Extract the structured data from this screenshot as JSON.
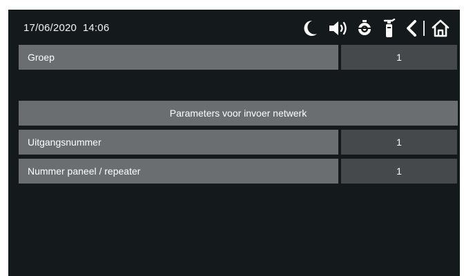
{
  "status_bar": {
    "date": "17/06/2020",
    "time": "14:06",
    "icons": [
      "moon-icon",
      "speaker-icon",
      "alarm-bell-icon",
      "fire-extinguisher-icon",
      "back-icon",
      "home-icon"
    ]
  },
  "rows": {
    "groep": {
      "label": "Groep",
      "value": "1"
    },
    "uitgangsnummer": {
      "label": "Uitgangsnummer",
      "value": "1"
    },
    "nummer_paneel": {
      "label": "Nummer paneel / repeater",
      "value": "1"
    }
  },
  "section": {
    "title": "Parameters voor invoer netwerk"
  },
  "colors": {
    "background": "#141a1c",
    "label_bg": "#6a6e71",
    "value_bg": "#46494c",
    "text": "#ffffff"
  }
}
